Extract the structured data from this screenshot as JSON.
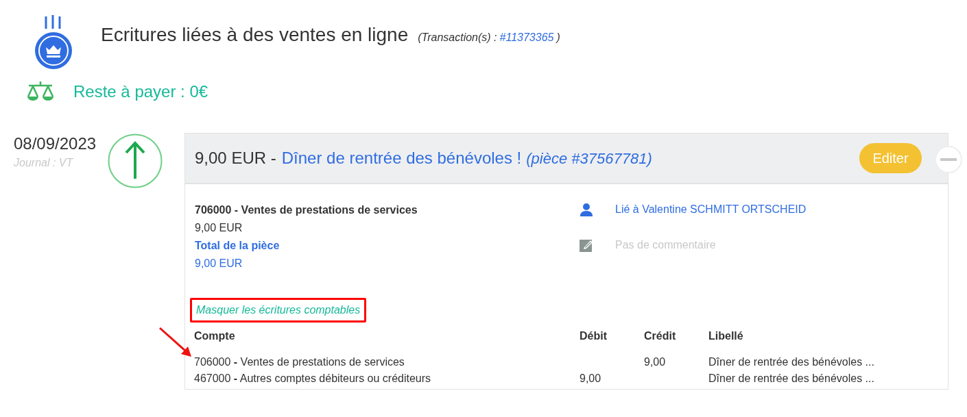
{
  "header": {
    "title": "Ecritures liées à des ventes en ligne",
    "transaction_label": "(Transaction(s) :",
    "transaction_link": "#11373365",
    "transaction_close": ")"
  },
  "balance": {
    "text": "Reste à payer : 0€"
  },
  "entry": {
    "date": "08/09/2023",
    "journal": "Journal : VT",
    "arrow_up": true,
    "amount": "9,00 EUR -",
    "title": "Dîner de rentrée des bénévoles !",
    "piece": "(pièce #37567781)",
    "edit_button": "Editer",
    "account": "706000 - Ventes de prestations de services",
    "account_amount": "9,00 EUR",
    "total_label": "Total de la pièce",
    "total_amount": "9,00 EUR",
    "linked": "Lié à Valentine SCHMITT ORTSCHEID",
    "comment": "Pas de commentaire",
    "toggle_link": "Masquer les écritures comptables",
    "highlighted": true,
    "table": {
      "columns": [
        "Compte",
        "Débit",
        "Crédit",
        "Libellé"
      ],
      "rows": [
        {
          "account": "706000 **-** Ventes de prestations de services",
          "debit": "",
          "credit": "9,00",
          "label": "Dîner de rentrée des bénévoles ..."
        },
        {
          "account": "467000 **-** Autres comptes débiteurs ou créditeurs",
          "debit": "9,00",
          "credit": "",
          "label": "Dîner de rentrée des bénévoles ..."
        }
      ]
    }
  }
}
